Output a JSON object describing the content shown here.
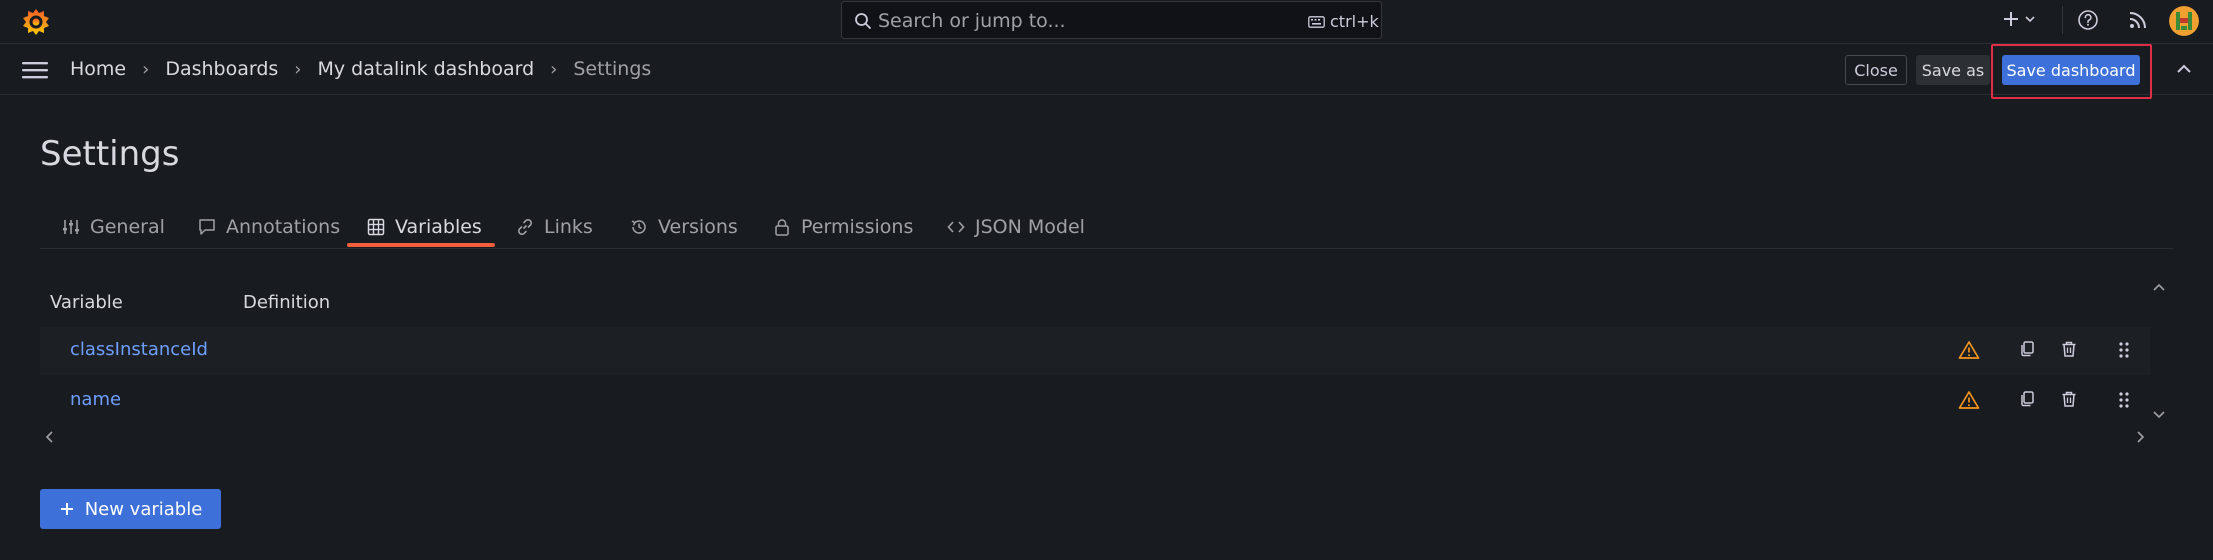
{
  "topbar": {
    "search_placeholder": "Search or jump to...",
    "search_shortcut": "ctrl+k"
  },
  "breadcrumb": {
    "items": [
      "Home",
      "Dashboards",
      "My datalink dashboard",
      "Settings"
    ]
  },
  "actions": {
    "close_label": "Close",
    "save_as_label": "Save as",
    "save_dashboard_label": "Save dashboard"
  },
  "page": {
    "title": "Settings"
  },
  "tabs": [
    {
      "label": "General",
      "icon": "sliders-icon"
    },
    {
      "label": "Annotations",
      "icon": "comment-icon"
    },
    {
      "label": "Variables",
      "icon": "table-icon",
      "active": true
    },
    {
      "label": "Links",
      "icon": "link-icon"
    },
    {
      "label": "Versions",
      "icon": "history-icon"
    },
    {
      "label": "Permissions",
      "icon": "lock-icon"
    },
    {
      "label": "JSON Model",
      "icon": "code-icon"
    }
  ],
  "table": {
    "columns": [
      "Variable",
      "Definition"
    ],
    "rows": [
      {
        "name": "classInstanceId",
        "definition": ""
      },
      {
        "name": "name",
        "definition": ""
      }
    ]
  },
  "new_variable_label": "New variable",
  "colors": {
    "background": "#181b1f",
    "primary": "#3d71d9",
    "link": "#6e9fff",
    "warning": "#f79520",
    "tab_underline": "#f55f3e",
    "highlight": "#e02f44"
  }
}
